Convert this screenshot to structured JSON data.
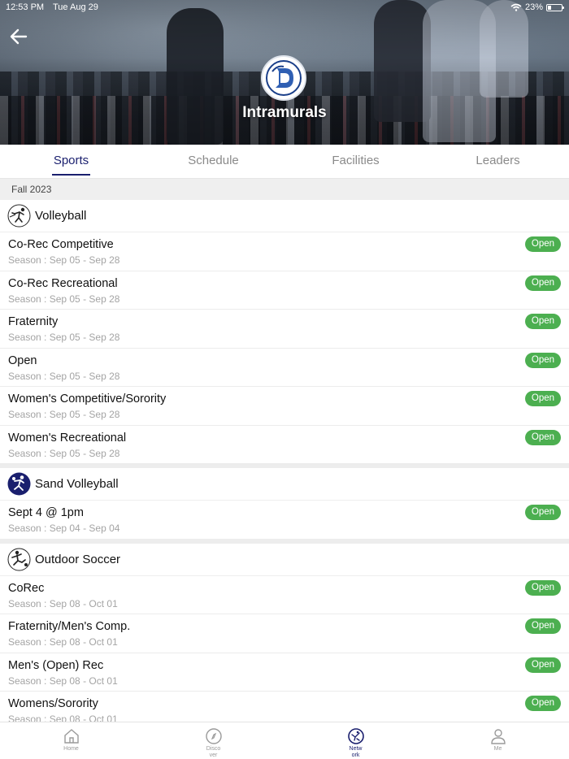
{
  "status": {
    "time": "12:53 PM",
    "date": "Tue Aug 29",
    "battery": "23%",
    "battery_level": 0.23
  },
  "header": {
    "title": "Intramurals"
  },
  "tabs": [
    {
      "label": "Sports",
      "active": true
    },
    {
      "label": "Schedule",
      "active": false
    },
    {
      "label": "Facilities",
      "active": false
    },
    {
      "label": "Leaders",
      "active": false
    }
  ],
  "term": "Fall 2023",
  "sports": [
    {
      "name": "Volleyball",
      "icon": "volleyball-icon",
      "leagues": [
        {
          "name": "Co-Rec Competitive",
          "season": "Season : Sep 05 - Sep 28",
          "status": "Open"
        },
        {
          "name": "Co-Rec Recreational",
          "season": "Season : Sep 05 - Sep 28",
          "status": "Open"
        },
        {
          "name": "Fraternity",
          "season": "Season : Sep 05 - Sep 28",
          "status": "Open"
        },
        {
          "name": "Open",
          "season": "Season : Sep 05 - Sep 28",
          "status": "Open"
        },
        {
          "name": "Women's Competitive/Sorority",
          "season": "Season : Sep 05 - Sep 28",
          "status": "Open"
        },
        {
          "name": "Women's Recreational",
          "season": "Season : Sep 05 - Sep 28",
          "status": "Open"
        }
      ]
    },
    {
      "name": "Sand Volleyball",
      "icon": "sand-volleyball-icon",
      "leagues": [
        {
          "name": "Sept 4 @ 1pm",
          "season": "Season : Sep 04 - Sep 04",
          "status": "Open"
        }
      ]
    },
    {
      "name": "Outdoor Soccer",
      "icon": "soccer-icon",
      "leagues": [
        {
          "name": "CoRec",
          "season": "Season : Sep 08 - Oct 01",
          "status": "Open"
        },
        {
          "name": "Fraternity/Men's Comp.",
          "season": "Season : Sep 08 - Oct 01",
          "status": "Open"
        },
        {
          "name": "Men's (Open) Rec",
          "season": "Season : Sep 08 - Oct 01",
          "status": "Open"
        },
        {
          "name": "Womens/Sorority",
          "season": "Season : Sep 08 - Oct 01",
          "status": "Open"
        }
      ]
    }
  ],
  "bottom_nav": [
    {
      "label": "Home",
      "icon": "home-icon",
      "active": false
    },
    {
      "label": "Disco ver",
      "icon": "compass-icon",
      "active": false
    },
    {
      "label": "Netw ork",
      "icon": "network-icon",
      "active": true
    },
    {
      "label": "Me",
      "icon": "person-icon",
      "active": false
    }
  ],
  "colors": {
    "accent": "#1a1f6e",
    "open_badge": "#4caf50",
    "muted": "#a4a4a4"
  }
}
